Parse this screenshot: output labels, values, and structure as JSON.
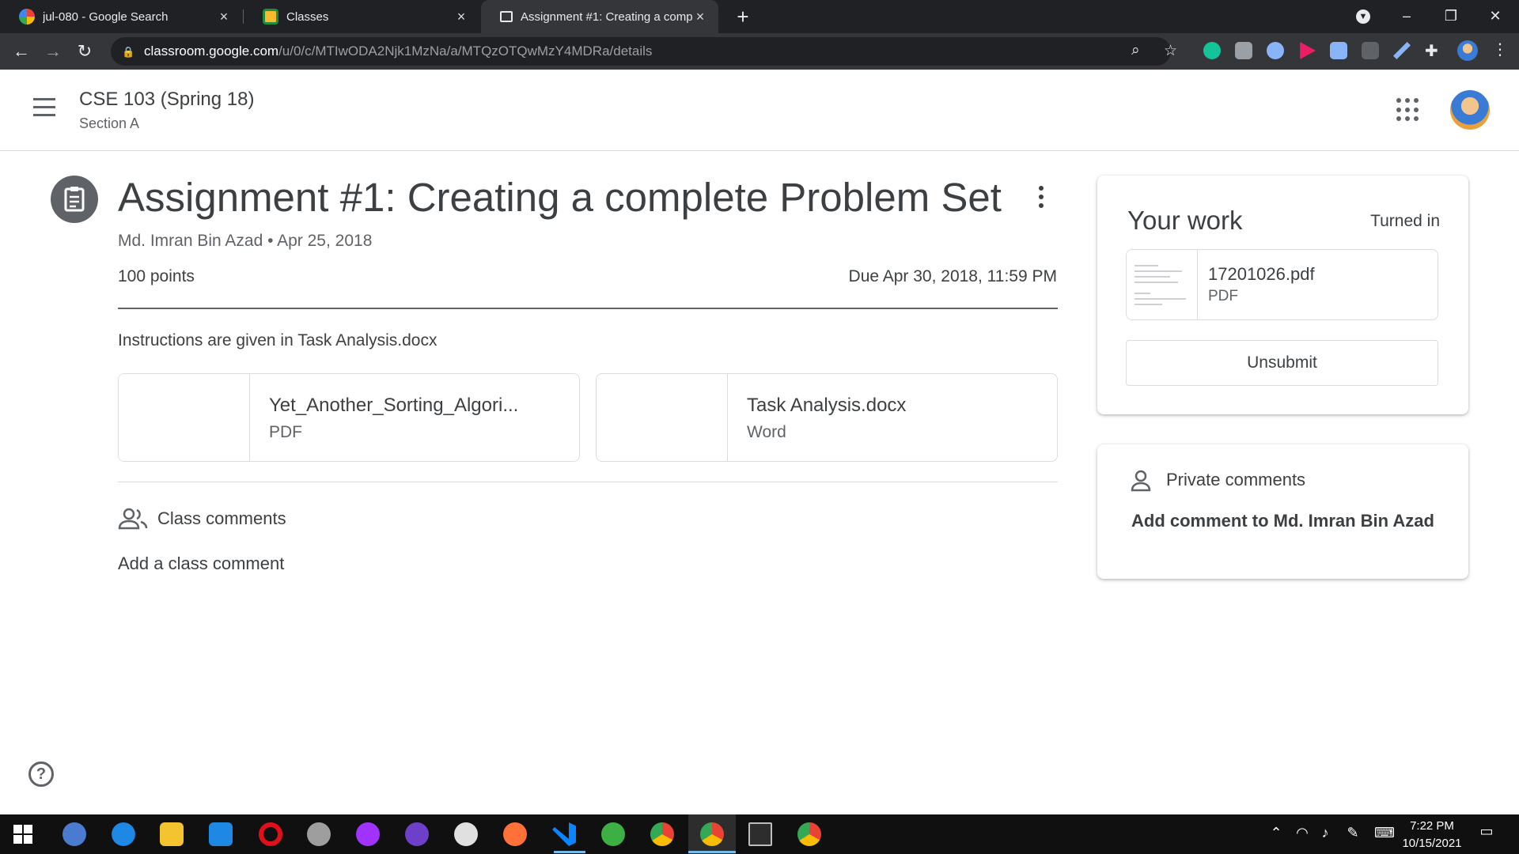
{
  "browser": {
    "tabs": [
      {
        "title": "jul-080 - Google Search",
        "active": false
      },
      {
        "title": "Classes",
        "active": false
      },
      {
        "title": "Assignment #1: Creating a comp",
        "active": true
      }
    ],
    "url_host": "classroom.google.com",
    "url_path": "/u/0/c/MTIwODA2Njk1MzNa/a/MTQzOTQwMzY4MDRa/details"
  },
  "header": {
    "class_title": "CSE 103 (Spring 18)",
    "class_section": "Section A"
  },
  "assignment": {
    "title": "Assignment #1: Creating a complete Problem Set",
    "meta": "Md. Imran Bin Azad • Apr 25, 2018",
    "points": "100 points",
    "due": "Due Apr 30, 2018, 11:59 PM",
    "instructions": "Instructions are given in Task Analysis.docx",
    "attachments": [
      {
        "name": "Yet_Another_Sorting_Algori...",
        "type": "PDF"
      },
      {
        "name": "Task Analysis.docx",
        "type": "Word"
      }
    ]
  },
  "class_comments": {
    "label": "Class comments",
    "add": "Add a class comment"
  },
  "your_work": {
    "title": "Your work",
    "status": "Turned in",
    "file_name": "17201026.pdf",
    "file_type": "PDF",
    "unsubmit_label": "Unsubmit"
  },
  "private_comments": {
    "label": "Private comments",
    "add": "Add comment to Md. Imran Bin Azad"
  },
  "taskbar": {
    "time": "7:22 PM",
    "date": "10/15/2021"
  },
  "colors": {
    "chrome_dark": "#202124",
    "toolbar": "#35363a",
    "text": "#3c4043",
    "secondary_text": "#5f6368",
    "border": "#dadce0"
  }
}
